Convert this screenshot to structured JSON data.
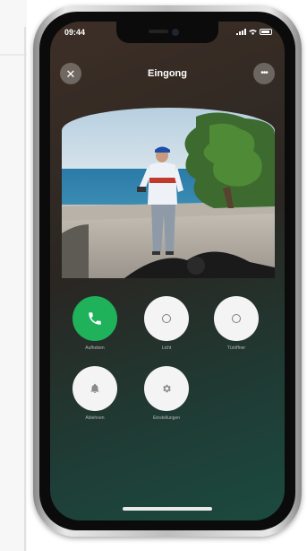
{
  "status_bar": {
    "time": "09:44"
  },
  "header": {
    "title": "Eingong",
    "close_icon": "close-icon",
    "more_icon": "more-icon"
  },
  "video": {
    "description_icon": "camera-feed"
  },
  "actions": [
    {
      "label": "Aufheben",
      "icon": "phone-icon",
      "color": "#1fb25a"
    },
    {
      "label": "Licht",
      "icon": "circle-icon"
    },
    {
      "label": "Türöffner",
      "icon": "circle-icon"
    },
    {
      "label": "Ablehnen",
      "icon": "bell-icon"
    },
    {
      "label": "Einstellungen",
      "icon": "gear-icon"
    }
  ]
}
